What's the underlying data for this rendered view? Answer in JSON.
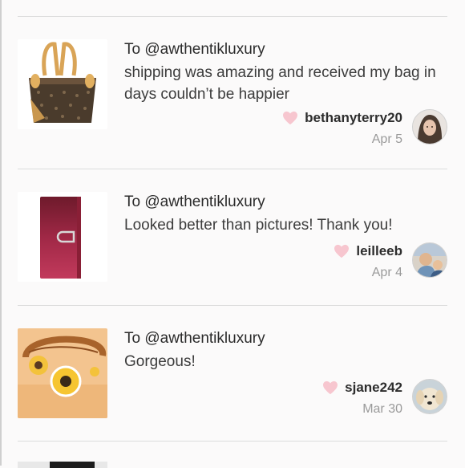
{
  "reviews": [
    {
      "to": "To @awthentikluxury",
      "comment": "shipping was amazing and received my bag in days couldn’t be happier",
      "username": "bethanyterry20",
      "date": "Apr 5",
      "thumb_icon": "monogram-tote-bag",
      "avatar_icon": "user-avatar"
    },
    {
      "to": "To @awthentikluxury",
      "comment": "Looked better than pictures! Thank you!",
      "username": "leilleeb",
      "date": "Apr 4",
      "thumb_icon": "red-wallet",
      "avatar_icon": "user-avatar"
    },
    {
      "to": "To @awthentikluxury",
      "comment": "Gorgeous!",
      "username": "sjane242",
      "date": "Mar 30",
      "thumb_icon": "flower-bracelet",
      "avatar_icon": "dog-avatar"
    }
  ],
  "colors": {
    "heart": "#f7c6cf",
    "divider": "#dcdcdc",
    "date": "#9a9a9a",
    "background": "#fbfafa"
  }
}
